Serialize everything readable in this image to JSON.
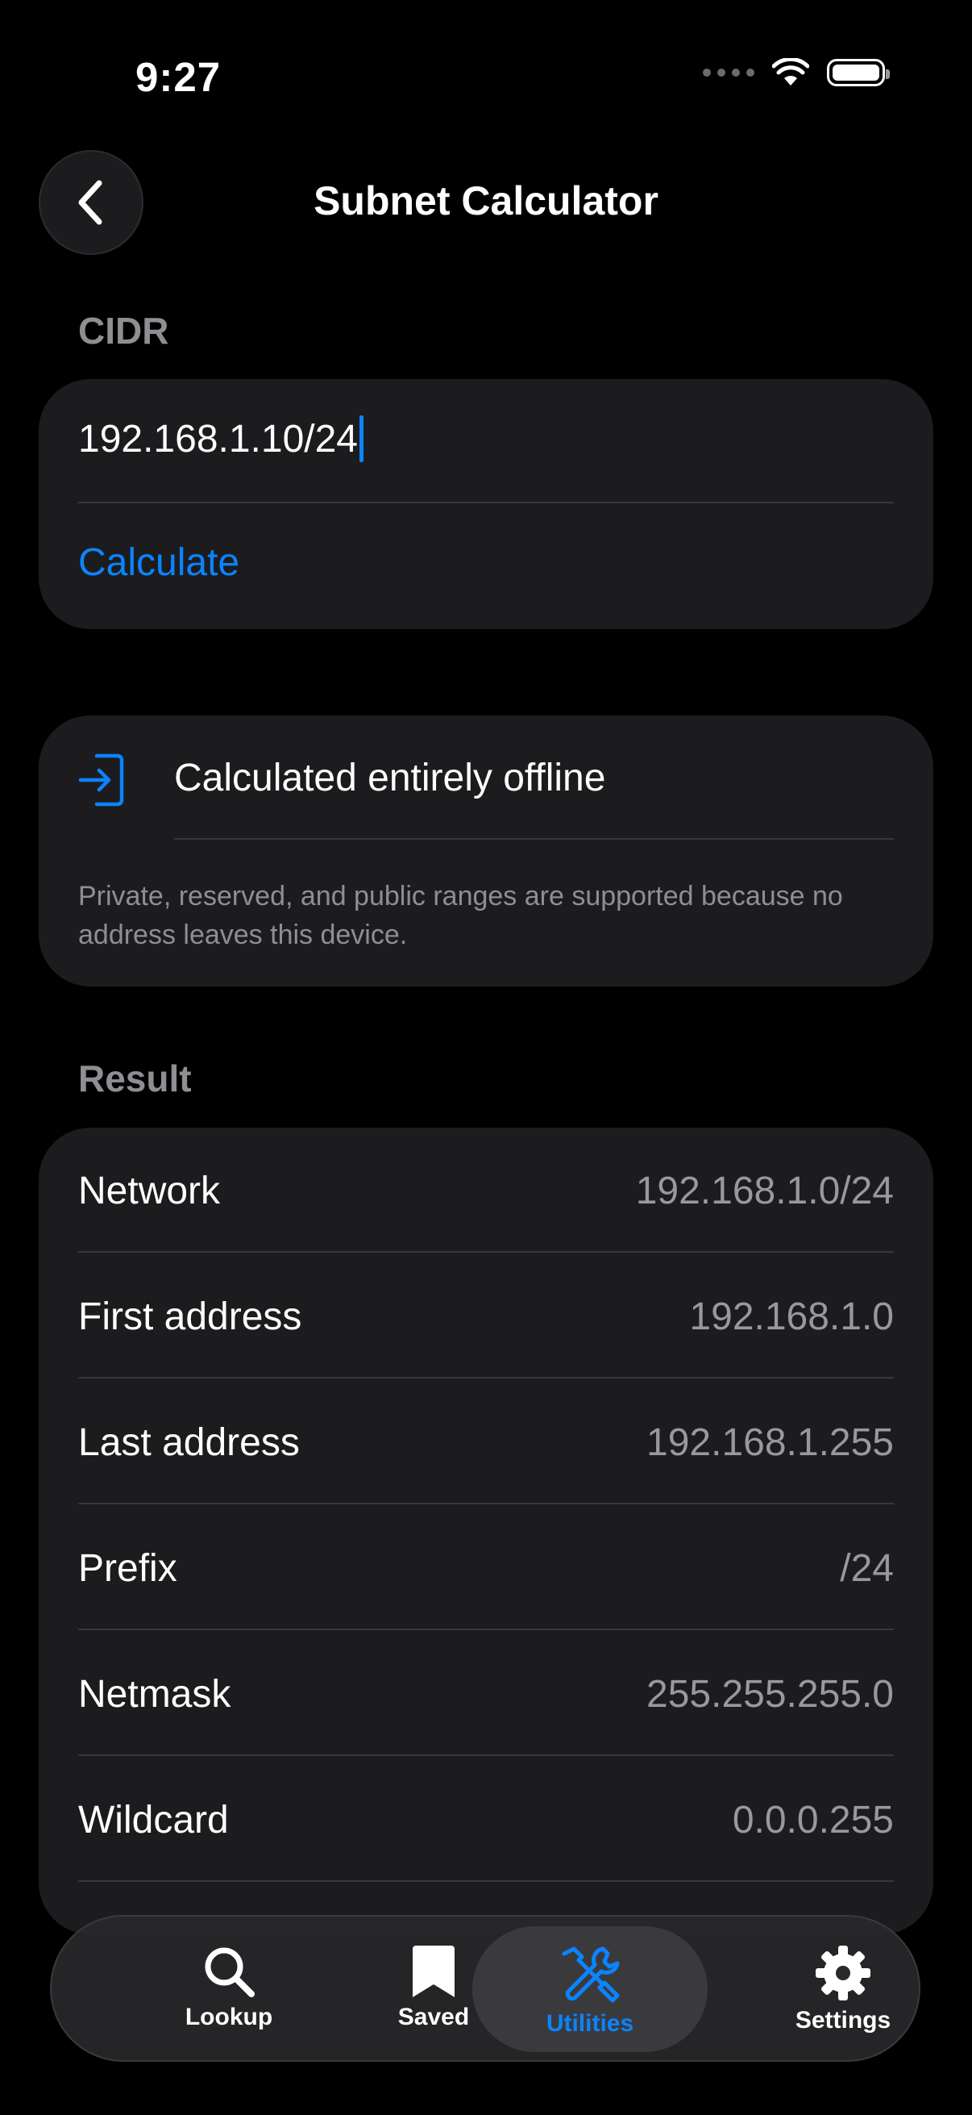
{
  "status_bar": {
    "time": "9:27"
  },
  "nav": {
    "title": "Subnet Calculator"
  },
  "cidr_section": {
    "label": "CIDR",
    "input_value": "192.168.1.10/24",
    "calculate_label": "Calculate"
  },
  "offline_card": {
    "title": "Calculated entirely offline",
    "description": "Private, reserved, and public ranges are supported because no address leaves this device."
  },
  "result_section": {
    "label": "Result",
    "rows": [
      {
        "key": "Network",
        "value": "192.168.1.0/24"
      },
      {
        "key": "First address",
        "value": "192.168.1.0"
      },
      {
        "key": "Last address",
        "value": "192.168.1.255"
      },
      {
        "key": "Prefix",
        "value": "/24"
      },
      {
        "key": "Netmask",
        "value": "255.255.255.0"
      },
      {
        "key": "Wildcard",
        "value": "0.0.0.255"
      }
    ]
  },
  "tabbar": {
    "tabs": [
      {
        "label": "Lookup",
        "icon": "magnifier-icon"
      },
      {
        "label": "Saved",
        "icon": "bookmark-icon"
      },
      {
        "label": "Utilities",
        "icon": "wrench-screwdriver-icon",
        "active": true
      },
      {
        "label": "Settings",
        "icon": "gear-icon"
      }
    ]
  },
  "colors": {
    "accent": "#0a84ff",
    "card": "#1c1c1e",
    "background": "#000000"
  }
}
